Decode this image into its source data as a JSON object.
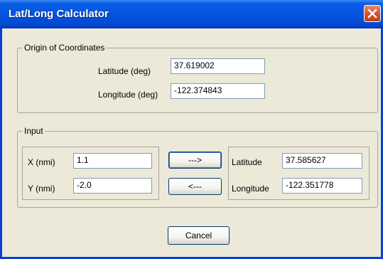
{
  "window": {
    "title": "Lat/Long Calculator"
  },
  "origin": {
    "legend": "Origin of Coordinates",
    "latitude_label": "Latitude (deg)",
    "latitude_value": "37.619002",
    "longitude_label": "Longitude (deg)",
    "longitude_value": "-122.374843"
  },
  "input": {
    "legend": "Input",
    "x_label": "X (nmi)",
    "x_value": "1.1",
    "y_label": "Y (nmi)",
    "y_value": "-2.0",
    "to_latlong_label": "--->",
    "to_xy_label": "<---",
    "latitude_label": "Latitude",
    "latitude_value": "37.585627",
    "longitude_label": "Longitude",
    "longitude_value": "-122.351778"
  },
  "buttons": {
    "cancel_label": "Cancel"
  },
  "icons": {
    "close": "close-icon"
  }
}
